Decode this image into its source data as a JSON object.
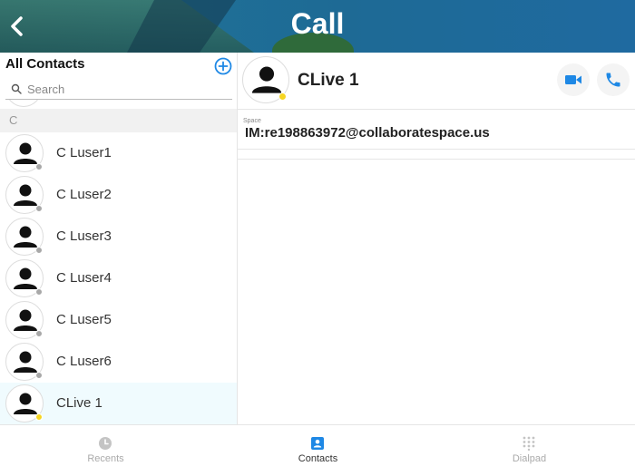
{
  "header": {
    "title": "Call"
  },
  "contacts_panel": {
    "title": "All Contacts",
    "search_placeholder": "Search",
    "section_letter": "C",
    "contacts": [
      {
        "name": "C Luser1",
        "status": "offline",
        "status_color": "#a8a8a8"
      },
      {
        "name": "C Luser2",
        "status": "offline",
        "status_color": "#a8a8a8"
      },
      {
        "name": "C Luser3",
        "status": "offline",
        "status_color": "#a8a8a8"
      },
      {
        "name": "C Luser4",
        "status": "offline",
        "status_color": "#a8a8a8"
      },
      {
        "name": "C Luser5",
        "status": "offline",
        "status_color": "#a8a8a8"
      },
      {
        "name": "C Luser6",
        "status": "offline",
        "status_color": "#a8a8a8"
      },
      {
        "name": "CLive 1",
        "status": "away",
        "status_color": "#f6d522",
        "selected": true
      }
    ]
  },
  "detail": {
    "name": "CLive 1",
    "status_color": "#f6d522",
    "space_label": "Space",
    "space_value": "IM:re198863972@collaboratespace.us"
  },
  "tabs": [
    {
      "label": "Recents",
      "icon": "clock-icon",
      "active": false
    },
    {
      "label": "Contacts",
      "icon": "contact-card-icon",
      "active": true
    },
    {
      "label": "Dialpad",
      "icon": "dialpad-icon",
      "active": false
    }
  ],
  "colors": {
    "accent": "#1e88e5",
    "header": "#1f6a95"
  }
}
